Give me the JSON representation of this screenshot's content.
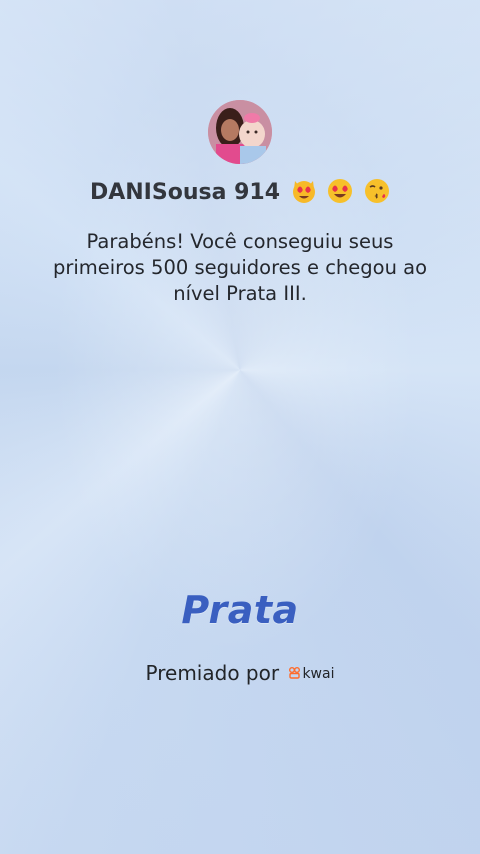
{
  "profile": {
    "username": "DANISousa 914",
    "emojis": [
      "heart-eyes-cat-emoji",
      "heart-eyes-emoji",
      "kissing-face-emoji"
    ]
  },
  "message": "Parabéns! Você conseguiu seus primeiros 500 seguidores e chegou ao nível Prata III.",
  "level": {
    "name": "Prata",
    "color": "#3a5fc0"
  },
  "footer": {
    "awarded_by": "Premiado por",
    "brand": "kwai",
    "brand_color": "#ff6a2a"
  }
}
